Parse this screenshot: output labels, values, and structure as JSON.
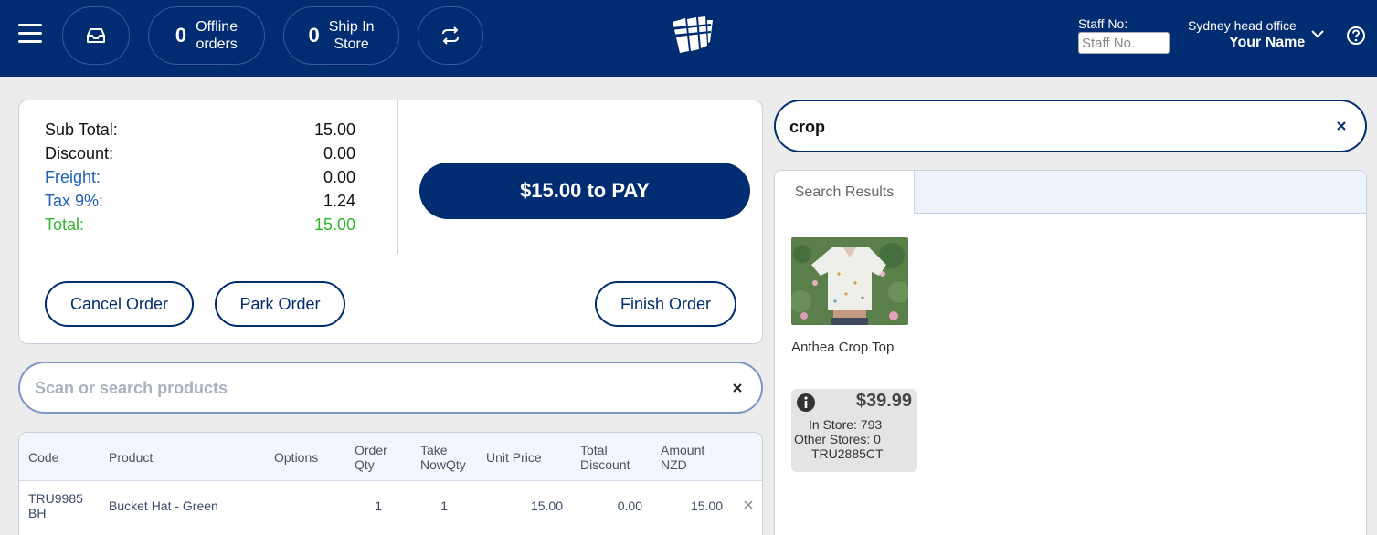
{
  "header": {
    "offline": {
      "count": "0",
      "label_line1": "Offline",
      "label_line2": "orders"
    },
    "ship": {
      "count": "0",
      "label_line1": "Ship In",
      "label_line2": "Store"
    },
    "staff_label": "Staff No:",
    "staff_placeholder": "Staff No.",
    "office": "Sydney head office",
    "user": "Your Name",
    "icons": [
      "menu-icon",
      "inbox-icon",
      "sync-icon",
      "logo",
      "chevron-down-icon",
      "help-icon"
    ]
  },
  "totals": {
    "rows": [
      {
        "label": "Sub Total:",
        "value": "15.00"
      },
      {
        "label": "Discount:",
        "value": "0.00"
      },
      {
        "label": "Freight:",
        "value": "0.00"
      },
      {
        "label": "Tax 9%:",
        "value": "1.24"
      },
      {
        "label": "Total:",
        "value": "15.00"
      }
    ],
    "pay_label": "$15.00 to PAY",
    "cancel_label": "Cancel Order",
    "park_label": "Park Order",
    "finish_label": "Finish Order"
  },
  "product_search": {
    "placeholder": "Scan or search products"
  },
  "order_table": {
    "headers": {
      "code": "Code",
      "product": "Product",
      "options": "Options",
      "order_qty_1": "Order",
      "order_qty_2": "Qty",
      "take_1": "Take",
      "take_2": "NowQty",
      "unit_price": "Unit Price",
      "total_disc_1": "Total",
      "total_disc_2": "Discount",
      "amount_1": "Amount",
      "amount_2": "NZD"
    },
    "rows": [
      {
        "code_1": "TRU9985",
        "code_2": "BH",
        "product": "Bucket Hat - Green",
        "options": "",
        "order_qty": "1",
        "take_now": "1",
        "unit_price": "15.00",
        "total_discount": "0.00",
        "amount": "15.00"
      }
    ]
  },
  "catalog_search": {
    "value": "crop"
  },
  "results": {
    "tab": "Search Results",
    "item": {
      "name": "Anthea Crop Top",
      "price": "$39.99",
      "in_store": "In Store: 793",
      "other_stores": "Other Stores: 0",
      "sku": "TRU2885CT"
    }
  },
  "colors": {
    "brand_navy": "#002d72",
    "link_blue": "#1f62b8",
    "total_green": "#2db82d",
    "background": "#ececec"
  }
}
